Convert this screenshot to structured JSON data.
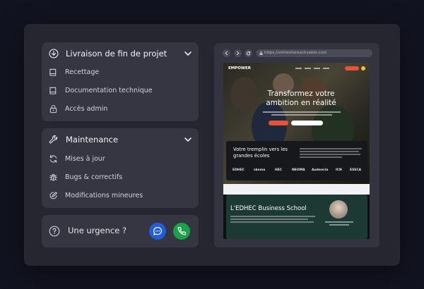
{
  "sidebar": {
    "delivery": {
      "title": "Livraison de fin de projet",
      "items": [
        {
          "label": "Recettage",
          "icon": "book-icon"
        },
        {
          "label": "Documentation technique",
          "icon": "book-icon"
        },
        {
          "label": "Accès admin",
          "icon": "lock-icon"
        }
      ]
    },
    "maintenance": {
      "title": "Maintenance",
      "items": [
        {
          "label": "Mises à jour",
          "icon": "refresh-icon"
        },
        {
          "label": "Bugs & correctifs",
          "icon": "bug-icon"
        },
        {
          "label": "Modifications mineures",
          "icon": "edit-icon"
        }
      ]
    },
    "urgency": {
      "label": "Une urgence ?"
    }
  },
  "browser": {
    "url": "https://votresitereactivable.com",
    "site": {
      "logo": "EMPOWER",
      "hero_title": "Transformez votre ambition en réalité",
      "band_title": "Votre tremplin vers les grandes écoles",
      "school_logos": [
        "EDHEC",
        "skema",
        "HEC",
        "NEOMA",
        "Audencia",
        "ICN",
        "ESSCA"
      ],
      "card_title": "L'EDHEC Business School"
    }
  },
  "colors": {
    "background": "#121320",
    "panel": "#25262f",
    "card": "#353642",
    "chat_button": "#1f5ed8",
    "phone_button": "#1aa24a",
    "site_accent": "#e8523a"
  }
}
